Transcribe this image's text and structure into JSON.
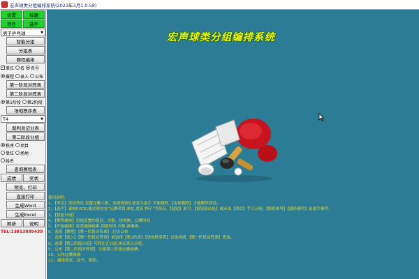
{
  "window": {
    "title": "宏声球类分组编排系统(2023年3月1.0.58)"
  },
  "sidebar": {
    "row1": {
      "left": "设置",
      "right": "标题"
    },
    "row2": {
      "left": "项目",
      "right": "选手"
    },
    "event_select": "男子乒乓球",
    "btn_smart_group": "智能分组",
    "btn_group_table": "分组表",
    "btn_match_arrange": "赛程编排",
    "option_unit": "单位",
    "option_name": "名",
    "option_seed": "名号",
    "mode_schedule": "赛程",
    "mode_entry": "录入",
    "mode_notice": "公布",
    "btn_stage1_table": "第一阶段对阵表",
    "btn_stage2_table": "第二阶段对阵表",
    "stage1": "第1阶段",
    "stage2": "第2阶段",
    "btn_venue_order": "场地秩序表",
    "table_count_select": "T4",
    "btn_referee_record": "裁判员记分表",
    "btn_stage2_group": "第二阶段分组",
    "order_label": "秩序",
    "order_event": "项目",
    "order_unit": "单位",
    "order_venue": "场地",
    "order_name": "姓名",
    "btn_query_schedule": "查询赛程表",
    "btn_results": "成绩",
    "btn_awards": "奖状",
    "btn_preview_print": "预览、打印",
    "btn_direct_print": "直接打印",
    "btn_gen_word": "生成Word",
    "btn_gen_excel": "生成Excel",
    "btn_refresh": "刷新",
    "btn_help": "说明",
    "tel": "TEL:13813889439"
  },
  "main": {
    "heading": "宏声球类分组编排系统",
    "instructions": [
      "使用说明:",
      "1、【项目】添加项目,设置比赛人数、加速或球队信息为选手,不能删除,【全部删除】才能删除项目。",
      "2、【选手】录制EXCEL格式表包含“比赛项目,单位,姓名,种子”字段名,【粘贴】即可,【按钮双击处】或点击【项目】手工分组,【随机排号】【顺序编号】给选手编号。",
      "3、【智能分组】",
      "4、【赛程编排】初始设置的组别、次数、场地数、比赛时间",
      "5、【开始编排】检查编排结果,调整时间,次数,再编排。",
      "6、选择【赛程】【第一阶段对阵表】,打印公布",
      "7、选择【录入】【第一阶段对阵表】或选择【第1阶段】【场地秩序表】记录成绩,【第一阶段对阵表】查询。",
      "8、选择【第二阶段分组】可转化正分组,排名表示分组。",
      "9、公布【第二阶段对阵表】,记录第二阶段比赛成绩。",
      "10、公布比赛成绩",
      "11、编辑奖状、证书、颁奖。"
    ]
  },
  "colors": {
    "main_bg": "#2b7c94",
    "heading": "#f2f01a",
    "instructions": "#d7d24a",
    "active_button": "#22d12f",
    "tel": "#e0141e"
  }
}
